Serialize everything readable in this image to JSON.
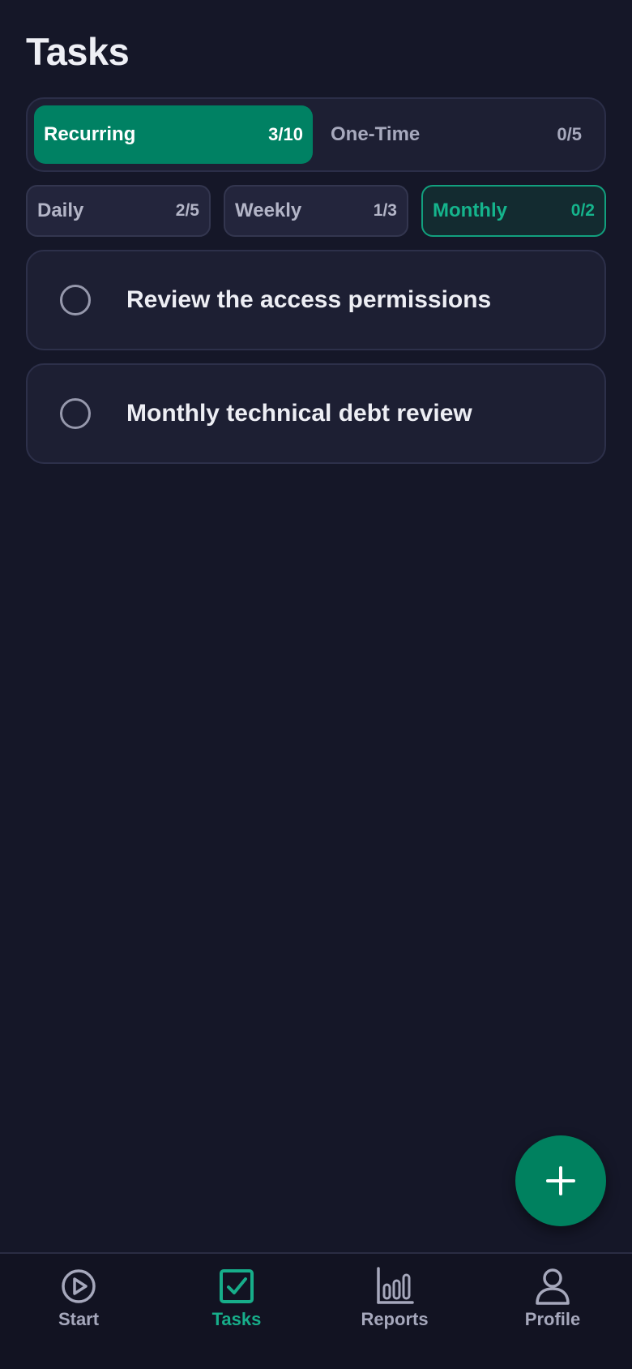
{
  "header": {
    "title": "Tasks"
  },
  "segment": {
    "recurring": {
      "label": "Recurring",
      "count": "3/10"
    },
    "one_time": {
      "label": "One-Time",
      "count": "0/5"
    }
  },
  "filters": [
    {
      "label": "Daily",
      "count": "2/5"
    },
    {
      "label": "Weekly",
      "count": "1/3"
    },
    {
      "label": "Monthly",
      "count": "0/2"
    }
  ],
  "tasks": [
    {
      "text": "Review the access permissions"
    },
    {
      "text": "Monthly technical debt review"
    }
  ],
  "fab": {
    "icon": "plus-icon"
  },
  "nav": {
    "items": [
      {
        "label": "Start",
        "icon": "play-circle-icon"
      },
      {
        "label": "Tasks",
        "icon": "check-square-icon"
      },
      {
        "label": "Reports",
        "icon": "bar-chart-icon"
      },
      {
        "label": "Profile",
        "icon": "user-icon"
      }
    ]
  },
  "colors": {
    "background": "#151728",
    "accent": "#008163",
    "accent_text": "#15B48C",
    "card": "#1D1F33"
  }
}
